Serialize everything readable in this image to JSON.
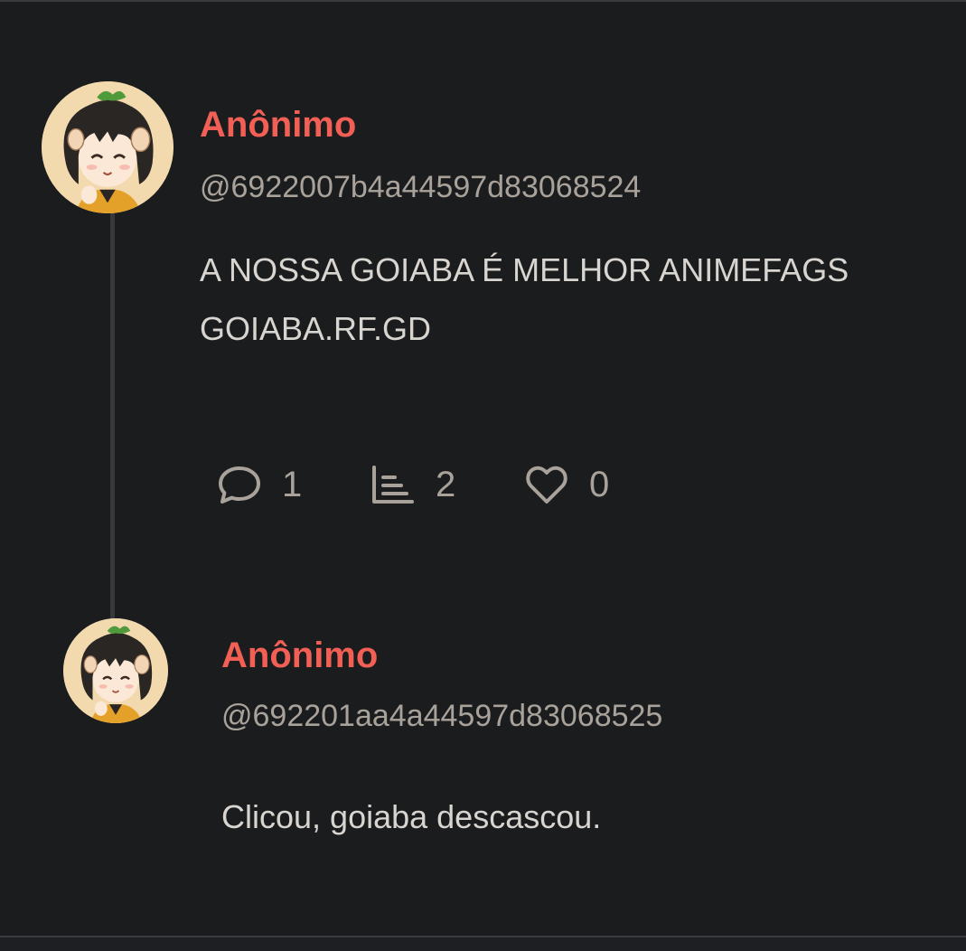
{
  "posts": [
    {
      "author": "Anônimo",
      "handle": "@6922007b4a44597d83068524",
      "lines": [
        "A NOSSA GOIABA É MELHOR ANIMEFAGS",
        "GOIABA.RF.GD"
      ],
      "actions": {
        "replies": {
          "icon": "comment-icon",
          "count": "1"
        },
        "stats": {
          "icon": "stats-icon",
          "count": "2"
        },
        "likes": {
          "icon": "heart-icon",
          "count": "0"
        }
      }
    },
    {
      "author": "Anônimo",
      "handle": "@692201aa4a44597d83068525",
      "lines": [
        "Clicou, goiaba descascou."
      ]
    }
  ],
  "colors": {
    "background": "#1b1c1e",
    "author": "#f25f55",
    "handle": "#a8a29a",
    "text": "#d8d5d0",
    "thread_line": "#38393c"
  },
  "avatar_icon": "anime-girl-avatar-icon"
}
